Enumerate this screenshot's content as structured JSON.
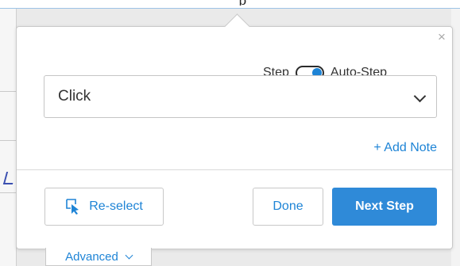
{
  "background": {
    "top_text": "p"
  },
  "popover": {
    "close_label": "×",
    "step_label": "Step",
    "auto_step_label": "Auto-Step",
    "auto_step_on": true,
    "action_select": {
      "value": "Click"
    },
    "add_note_label": "+ Add Note",
    "reselect_label": "Re-select",
    "done_label": "Done",
    "next_step_label": "Next Step",
    "advanced_label": "Advanced"
  },
  "colors": {
    "accent": "#1e84d6",
    "primary_button": "#2f8ad8",
    "border": "#c8c8c8"
  },
  "icons": {
    "close": "close-icon",
    "reselect": "cursor-select-icon",
    "select_chevron": "chevron-down-icon",
    "advanced_chevron": "chevron-down-icon"
  }
}
